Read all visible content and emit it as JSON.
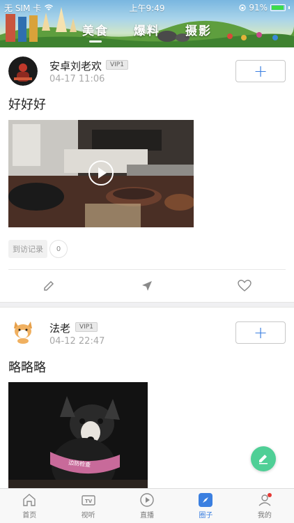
{
  "status_bar": {
    "carrier": "无 SIM 卡",
    "time": "上午9:49",
    "battery": "91%",
    "battery_level": 0.91
  },
  "header": {
    "tabs": [
      {
        "label": "美食",
        "active": true
      },
      {
        "label": "爆料",
        "active": false
      },
      {
        "label": "摄影",
        "active": false
      }
    ]
  },
  "posts": [
    {
      "username": "安卓刘老欢",
      "vip": "VIP1",
      "timestamp": "04-17 11:06",
      "text": "好好好",
      "media_type": "video",
      "visit_label": "到访记录",
      "visit_count": "0",
      "actions": [
        "edit-icon",
        "send-icon",
        "heart-icon"
      ]
    },
    {
      "username": "法老",
      "vip": "VIP1",
      "timestamp": "04-12 22:47",
      "text": "略略略",
      "media_type": "image",
      "harness_text": "边防检查"
    }
  ],
  "bottom_nav": {
    "items": [
      {
        "label": "首页",
        "icon": "home-icon",
        "active": false
      },
      {
        "label": "视听",
        "icon": "tv-icon",
        "active": false
      },
      {
        "label": "直播",
        "icon": "play-circle-icon",
        "active": false
      },
      {
        "label": "圈子",
        "icon": "compass-icon",
        "active": true
      },
      {
        "label": "我的",
        "icon": "user-icon",
        "active": false
      }
    ]
  },
  "colors": {
    "accent": "#3b7fe0",
    "fab": "#4fcf96",
    "notification_dot": "#e53935"
  }
}
